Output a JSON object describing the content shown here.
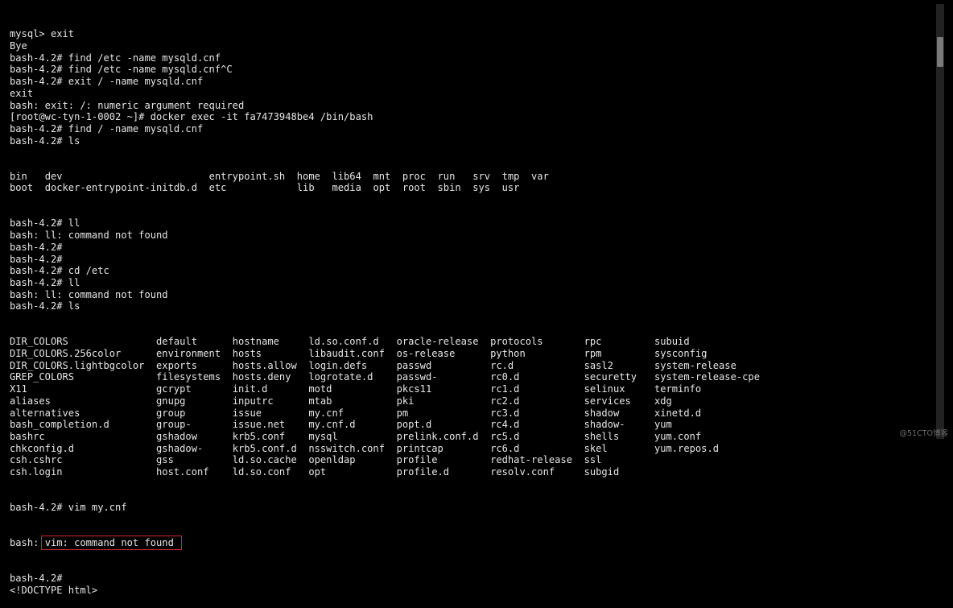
{
  "terminal": {
    "lines_before": [
      "mysql> exit",
      "Bye",
      "bash-4.2# find /etc -name mysqld.cnf",
      "bash-4.2# find /etc -name mysqld.cnf^C",
      "bash-4.2# exit / -name mysqld.cnf",
      "exit",
      "bash: exit: /: numeric argument required",
      "[root@wc-tyn-1-0002 ~]# docker exec -it fa7473948be4 /bin/bash",
      "bash-4.2# find / -name mysqld.cnf",
      "bash-4.2# ls"
    ],
    "root_ls": [
      [
        "bin",
        "dev",
        "entrypoint.sh",
        "home",
        "lib64",
        "mnt",
        "proc",
        "run",
        "srv",
        "tmp",
        "var"
      ],
      [
        "boot",
        "docker-entrypoint-initdb.d",
        "etc",
        "lib",
        "media",
        "opt",
        "root",
        "sbin",
        "sys",
        "usr"
      ]
    ],
    "lines_middle": [
      "bash-4.2# ll",
      "bash: ll: command not found",
      "bash-4.2# ",
      "bash-4.2# ",
      "bash-4.2# cd /etc",
      "bash-4.2# ll",
      "bash: ll: command not found",
      "bash-4.2# ls"
    ],
    "etc_ls": [
      [
        "DIR_COLORS",
        "default",
        "hostname",
        "ld.so.conf.d",
        "oracle-release",
        "protocols",
        "rpc",
        "subuid"
      ],
      [
        "DIR_COLORS.256color",
        "environment",
        "hosts",
        "libaudit.conf",
        "os-release",
        "python",
        "rpm",
        "sysconfig"
      ],
      [
        "DIR_COLORS.lightbgcolor",
        "exports",
        "hosts.allow",
        "login.defs",
        "passwd",
        "rc.d",
        "sasl2",
        "system-release"
      ],
      [
        "GREP_COLORS",
        "filesystems",
        "hosts.deny",
        "logrotate.d",
        "passwd-",
        "rc0.d",
        "securetty",
        "system-release-cpe"
      ],
      [
        "X11",
        "gcrypt",
        "init.d",
        "motd",
        "pkcs11",
        "rc1.d",
        "selinux",
        "terminfo"
      ],
      [
        "aliases",
        "gnupg",
        "inputrc",
        "mtab",
        "pki",
        "rc2.d",
        "services",
        "xdg"
      ],
      [
        "alternatives",
        "group",
        "issue",
        "my.cnf",
        "pm",
        "rc3.d",
        "shadow",
        "xinetd.d"
      ],
      [
        "bash_completion.d",
        "group-",
        "issue.net",
        "my.cnf.d",
        "popt.d",
        "rc4.d",
        "shadow-",
        "yum"
      ],
      [
        "bashrc",
        "gshadow",
        "krb5.conf",
        "mysql",
        "prelink.conf.d",
        "rc5.d",
        "shells",
        "yum.conf"
      ],
      [
        "chkconfig.d",
        "gshadow-",
        "krb5.conf.d",
        "nsswitch.conf",
        "printcap",
        "rc6.d",
        "skel",
        "yum.repos.d"
      ],
      [
        "csh.cshrc",
        "gss",
        "ld.so.cache",
        "openldap",
        "profile",
        "redhat-release",
        "ssl"
      ],
      [
        "csh.login",
        "host.conf",
        "ld.so.conf",
        "opt",
        "profile.d",
        "resolv.conf",
        "subgid"
      ]
    ],
    "vim_cmd": "bash-4.2# vim my.cnf",
    "error_prefix": "bash: ",
    "error_highlighted": "vim: command not found",
    "lines_after": [
      "bash-4.2# ",
      "<!DOCTYPE html>"
    ],
    "highlight_color": "#d0262b"
  },
  "watermark": "@51CTO博客"
}
